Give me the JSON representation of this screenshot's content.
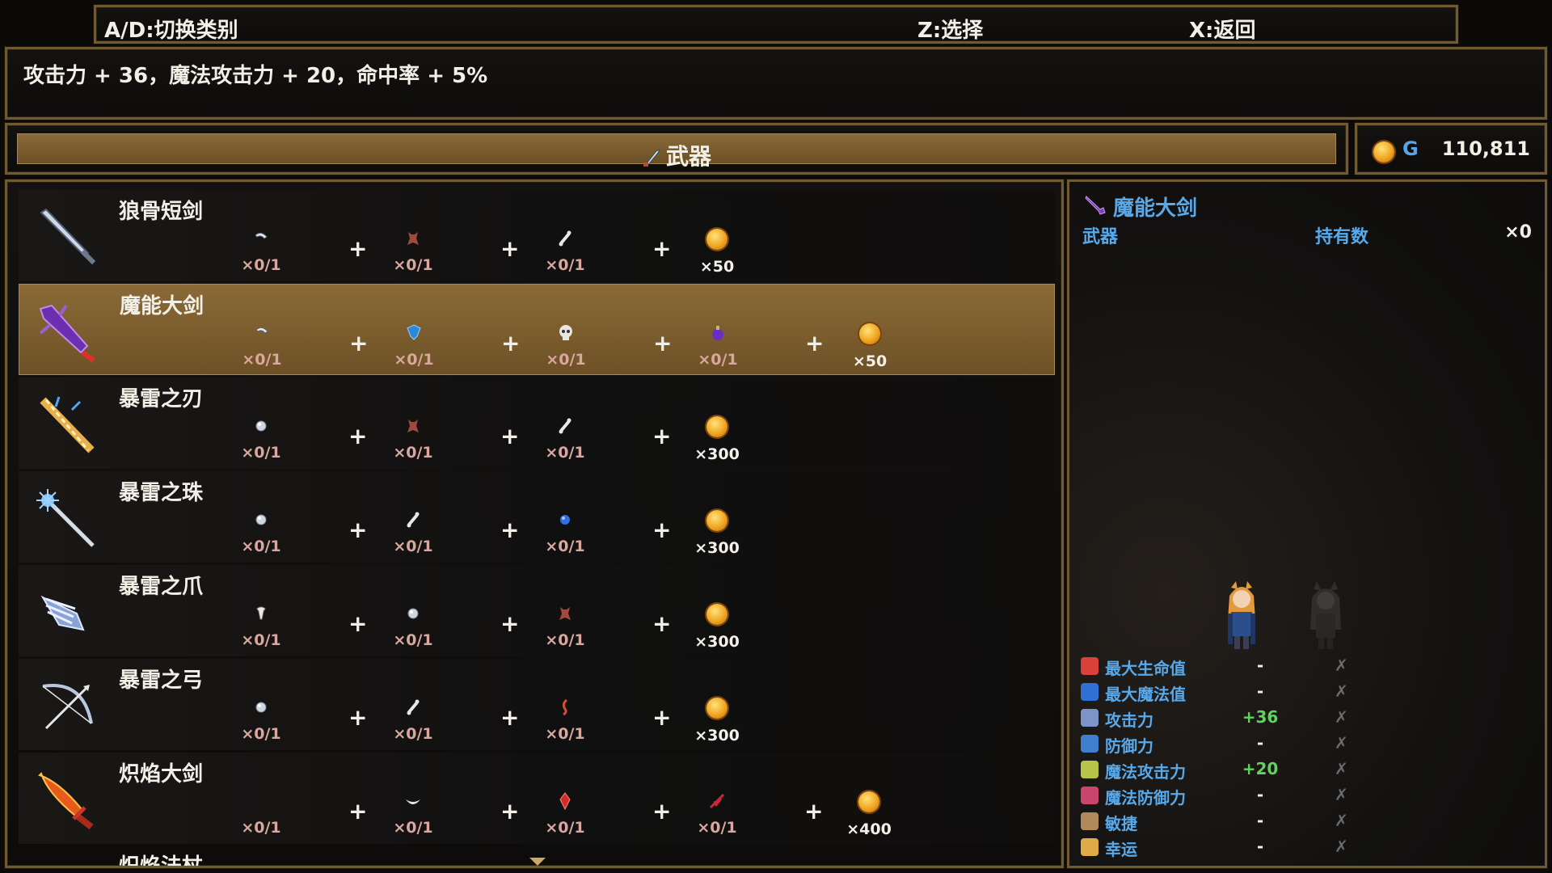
{
  "controls": {
    "switch": "A/D:切换类别",
    "select": "Z:选择",
    "back": "X:返回"
  },
  "description": "攻击力 + 36，魔法攻击力 + 20，命中率 + 5%",
  "category": {
    "label": "武器",
    "icon": "sword-brush-icon"
  },
  "gold": {
    "symbol": "G",
    "value": "110,811"
  },
  "recipes": [
    {
      "name": "狼骨短剑",
      "icon": "silver-sword-icon",
      "selected": false,
      "materials": [
        {
          "icon": "claw-icon",
          "count": "×0/1"
        },
        {
          "icon": "pelt-icon",
          "count": "×0/1"
        },
        {
          "icon": "bone-icon",
          "count": "×0/1"
        },
        {
          "icon": "gold-coin-icon",
          "count": "×50"
        }
      ]
    },
    {
      "name": "魔能大剑",
      "icon": "purple-greatsword-icon",
      "selected": true,
      "materials": [
        {
          "icon": "claw-icon",
          "count": "×0/1"
        },
        {
          "icon": "blue-crystal-icon",
          "count": "×0/1"
        },
        {
          "icon": "skull-icon",
          "count": "×0/1"
        },
        {
          "icon": "purple-potion-icon",
          "count": "×0/1"
        },
        {
          "icon": "gold-coin-icon",
          "count": "×50"
        }
      ]
    },
    {
      "name": "暴雷之刃",
      "icon": "thunder-blade-icon",
      "selected": false,
      "materials": [
        {
          "icon": "silver-orb-icon",
          "count": "×0/1"
        },
        {
          "icon": "pelt-icon",
          "count": "×0/1"
        },
        {
          "icon": "bone-icon",
          "count": "×0/1"
        },
        {
          "icon": "gold-coin-icon",
          "count": "×300"
        }
      ]
    },
    {
      "name": "暴雷之珠",
      "icon": "thunder-staff-icon",
      "selected": false,
      "materials": [
        {
          "icon": "silver-orb-icon",
          "count": "×0/1"
        },
        {
          "icon": "bone-icon",
          "count": "×0/1"
        },
        {
          "icon": "blue-orb-icon",
          "count": "×0/1"
        },
        {
          "icon": "gold-coin-icon",
          "count": "×300"
        }
      ]
    },
    {
      "name": "暴雷之爪",
      "icon": "thunder-claw-icon",
      "selected": false,
      "materials": [
        {
          "icon": "fang-icon",
          "count": "×0/1"
        },
        {
          "icon": "silver-orb-icon",
          "count": "×0/1"
        },
        {
          "icon": "pelt-icon",
          "count": "×0/1"
        },
        {
          "icon": "gold-coin-icon",
          "count": "×300"
        }
      ]
    },
    {
      "name": "暴雷之弓",
      "icon": "thunder-bow-icon",
      "selected": false,
      "materials": [
        {
          "icon": "silver-orb-icon",
          "count": "×0/1"
        },
        {
          "icon": "bone-icon",
          "count": "×0/1"
        },
        {
          "icon": "red-hook-icon",
          "count": "×0/1"
        },
        {
          "icon": "gold-coin-icon",
          "count": "×300"
        }
      ]
    },
    {
      "name": "炽焰大剑",
      "icon": "flame-greatsword-icon",
      "selected": false,
      "materials": [
        {
          "icon": "crescent-icon",
          "count": "×0/1"
        },
        {
          "icon": "white-crescent-icon",
          "count": "×0/1"
        },
        {
          "icon": "red-gem-icon",
          "count": "×0/1"
        },
        {
          "icon": "red-feather-icon",
          "count": "×0/1"
        },
        {
          "icon": "gold-coin-icon",
          "count": "×400"
        }
      ]
    }
  ],
  "next_item_partial": "炽焰法杖",
  "detail": {
    "name": "魔能大剑",
    "type": "武器",
    "hold_label": "持有数",
    "hold_value": "×0",
    "stats": [
      {
        "label": "最大生命值",
        "icon": "heart-icon",
        "value": "-",
        "other": "✗",
        "color": "#d9413a"
      },
      {
        "label": "最大魔法值",
        "icon": "mana-orb-icon",
        "value": "-",
        "other": "✗",
        "color": "#2f6fd6"
      },
      {
        "label": "攻击力",
        "icon": "attack-icon",
        "value": "+36",
        "other": "✗",
        "color": "#7d94c9"
      },
      {
        "label": "防御力",
        "icon": "shield-icon",
        "value": "-",
        "other": "✗",
        "color": "#3f7fd0"
      },
      {
        "label": "魔法攻击力",
        "icon": "wand-icon",
        "value": "+20",
        "other": "✗",
        "color": "#b7c44a"
      },
      {
        "label": "魔法防御力",
        "icon": "hat-icon",
        "value": "-",
        "other": "✗",
        "color": "#c9456d"
      },
      {
        "label": "敏捷",
        "icon": "boot-icon",
        "value": "-",
        "other": "✗",
        "color": "#b08a5a"
      },
      {
        "label": "幸运",
        "icon": "star-icon",
        "value": "-",
        "other": "✗",
        "color": "#e0a94a"
      }
    ]
  }
}
